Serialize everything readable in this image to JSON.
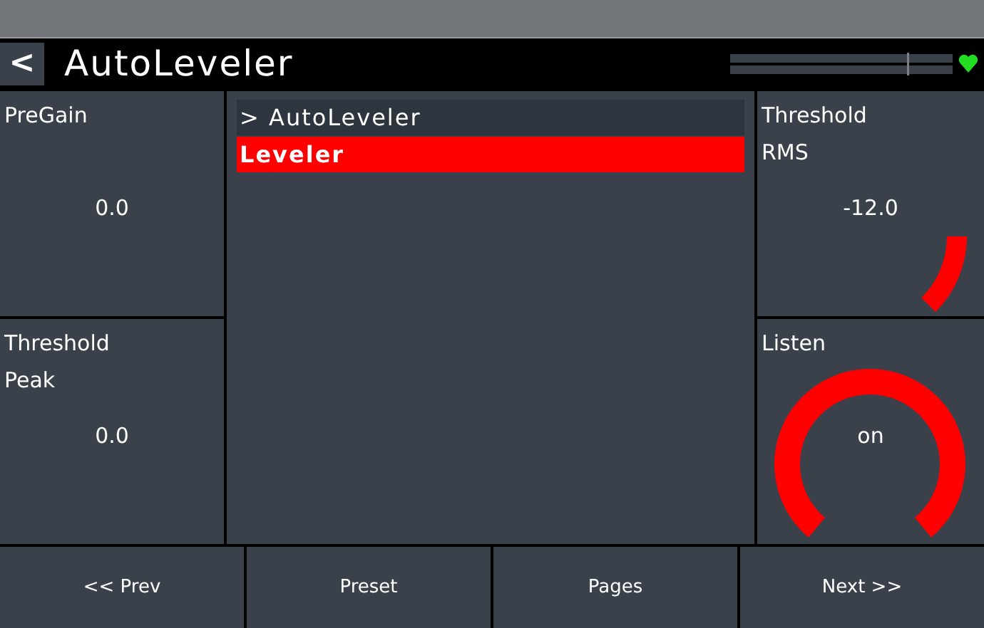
{
  "header": {
    "back": "<",
    "title": "AutoLeveler"
  },
  "left_params": [
    {
      "label": "PreGain",
      "value": "0.0"
    },
    {
      "label": "Threshold\nPeak",
      "value": "0.0"
    }
  ],
  "list": [
    {
      "label": "> AutoLeveler",
      "selected": false
    },
    {
      "label": "Leveler",
      "selected": true
    }
  ],
  "right_params": [
    {
      "kind": "knob",
      "label": "Threshold\nRMS",
      "value": "-12.0"
    },
    {
      "kind": "toggle",
      "label": "Listen",
      "value": "on",
      "on": true
    }
  ],
  "footer": [
    "<< Prev",
    "Preset",
    "Pages",
    "Next >>"
  ]
}
